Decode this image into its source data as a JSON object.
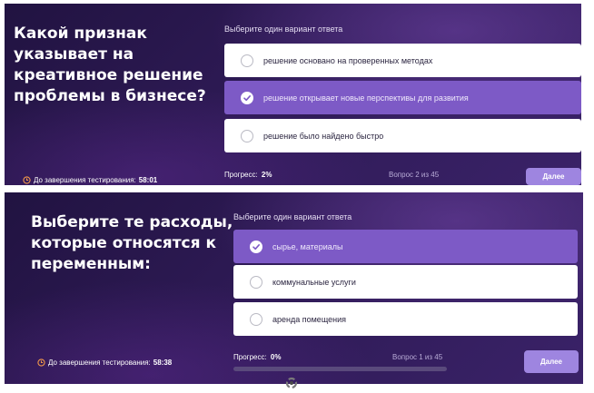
{
  "screens": [
    {
      "question": "Какой признак\nуказывает на\nкреативное решение\nпроблемы в бизнесе?",
      "instruction": "Выберите один вариант ответа",
      "options": [
        {
          "label": "решение основано на проверенных методах",
          "selected": false
        },
        {
          "label": "решение открывает новые перспективы для развития",
          "selected": true
        },
        {
          "label": "решение было найдено быстро",
          "selected": false
        }
      ],
      "timer_label": "До завершения тестирования:",
      "timer_value": "58:01",
      "progress_label": "Прогресс:",
      "progress_value": "2%",
      "progress_fraction": 0.02,
      "counter": "Вопрос 2 из 45",
      "next_label": "Далее"
    },
    {
      "question": "Выберите те расходы,\nкоторые относятся к\nпеременным:",
      "instruction": "Выберите один вариант ответа",
      "options": [
        {
          "label": "сырье, материалы",
          "selected": true
        },
        {
          "label": "коммунальные услуги",
          "selected": false
        },
        {
          "label": "аренда помещения",
          "selected": false
        }
      ],
      "timer_label": "До завершения тестирования:",
      "timer_value": "58:38",
      "progress_label": "Прогресс:",
      "progress_value": "0%",
      "progress_fraction": 0.0,
      "counter": "Вопрос 1 из 45",
      "next_label": "Далее"
    }
  ],
  "colors": {
    "selected_option": "#7d5ac6",
    "next_button": "#9e85e0",
    "panel_bg": "#2e1a55"
  },
  "icons": {
    "timer": "clock-icon",
    "check": "check-icon",
    "cursor": "busy-cursor-icon"
  }
}
